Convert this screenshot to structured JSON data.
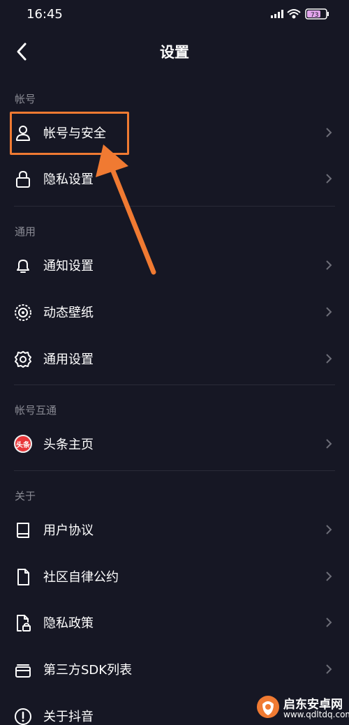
{
  "status_bar": {
    "time": "16:45",
    "battery": "73"
  },
  "nav": {
    "title": "设置"
  },
  "sections": {
    "account": {
      "header": "帐号",
      "items": [
        "帐号与安全",
        "隐私设置"
      ]
    },
    "general": {
      "header": "通用",
      "items": [
        "通知设置",
        "动态壁纸",
        "通用设置"
      ]
    },
    "linked": {
      "header": "帐号互通",
      "items": [
        "头条主页"
      ]
    },
    "about": {
      "header": "关于",
      "items": [
        "用户协议",
        "社区自律公约",
        "隐私政策",
        "第三方SDK列表",
        "关于抖音"
      ]
    }
  },
  "toutiao_badge": "头条",
  "watermark": {
    "name": "启东安卓网",
    "url": "www.qdltdq.com"
  },
  "colors": {
    "background": "#161724",
    "highlight": "#f07a32",
    "muted_text": "#8a8b94"
  }
}
